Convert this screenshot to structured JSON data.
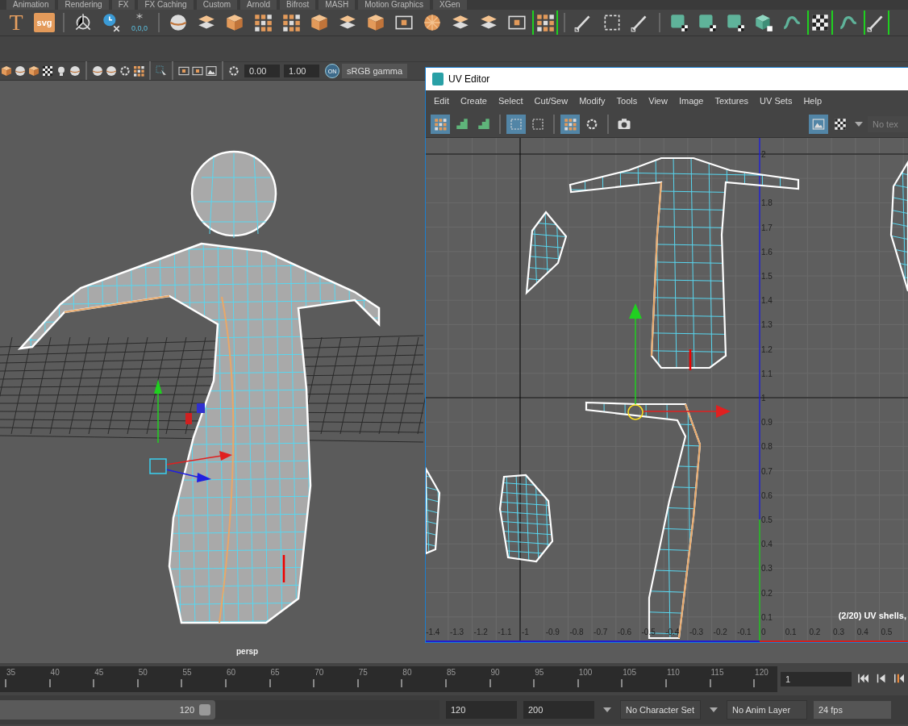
{
  "shelf_tabs": [
    "Animation",
    "Rendering",
    "FX",
    "FX Caching",
    "Custom",
    "Arnold",
    "Bifrost",
    "MASH",
    "Motion Graphics",
    "XGen"
  ],
  "shelf_groups": [
    [
      {
        "kind": "text",
        "label": "T",
        "selected": false
      },
      {
        "kind": "badge",
        "label": "svg",
        "selected": false
      }
    ],
    [
      {
        "kind": "pivot",
        "selected": false
      },
      {
        "kind": "clock",
        "selected": false
      },
      {
        "kind": "snowflake",
        "label": "0,0,0",
        "selected": false
      }
    ],
    [
      {
        "kind": "sphere",
        "selected": false
      },
      {
        "kind": "tiles",
        "selected": false
      },
      {
        "kind": "cube",
        "selected": false
      },
      {
        "kind": "grid",
        "selected": false
      },
      {
        "kind": "grid",
        "selected": false
      },
      {
        "kind": "cube",
        "selected": false
      },
      {
        "kind": "tiles",
        "selected": false
      },
      {
        "kind": "cube",
        "selected": false
      },
      {
        "kind": "square",
        "selected": false
      },
      {
        "kind": "wheel",
        "selected": false
      },
      {
        "kind": "tiles",
        "selected": false
      },
      {
        "kind": "tiles",
        "selected": false
      },
      {
        "kind": "square",
        "selected": false
      },
      {
        "kind": "grid",
        "selected": true
      }
    ],
    [
      {
        "kind": "pen",
        "selected": false
      },
      {
        "kind": "frame",
        "selected": false
      },
      {
        "kind": "pen",
        "selected": false
      }
    ],
    [
      {
        "kind": "teal-square",
        "selected": false
      },
      {
        "kind": "teal-square",
        "selected": false
      },
      {
        "kind": "teal-square",
        "selected": false
      },
      {
        "kind": "teal-cube",
        "selected": false
      },
      {
        "kind": "wave",
        "selected": false
      },
      {
        "kind": "checker",
        "selected": true
      },
      {
        "kind": "wave",
        "selected": false
      },
      {
        "kind": "pen",
        "selected": true
      }
    ]
  ],
  "viewport_toolbar": {
    "groups": [
      [
        {
          "kind": "cube"
        },
        {
          "kind": "sphere"
        },
        {
          "kind": "cube"
        },
        {
          "kind": "checker"
        },
        {
          "kind": "bulb"
        },
        {
          "kind": "sphere"
        }
      ],
      [
        {
          "kind": "sphere"
        },
        {
          "kind": "sphere"
        },
        {
          "kind": "ring"
        },
        {
          "kind": "grid"
        }
      ],
      [
        {
          "kind": "select"
        }
      ],
      [
        {
          "kind": "square"
        },
        {
          "kind": "square"
        },
        {
          "kind": "image"
        }
      ],
      [
        {
          "kind": "ring"
        }
      ]
    ],
    "exposure": "0.00",
    "gamma": "1.00",
    "color_management": {
      "label": "ON",
      "on": true
    },
    "view_transform": "sRGB gamma"
  },
  "viewport": {
    "camera": "persp"
  },
  "uv_editor": {
    "title": "UV Editor",
    "menus": [
      "Edit",
      "Create",
      "Select",
      "Cut/Sew",
      "Modify",
      "Tools",
      "View",
      "Image",
      "Textures",
      "UV Sets",
      "Help"
    ],
    "toolbar_groups": [
      [
        {
          "kind": "grid",
          "selected": true
        },
        {
          "kind": "stairs",
          "selected": false
        },
        {
          "kind": "stairs",
          "selected": false
        }
      ],
      [
        {
          "kind": "frame",
          "selected": true
        },
        {
          "kind": "frame",
          "selected": false
        }
      ],
      [
        {
          "kind": "grid",
          "selected": true
        },
        {
          "kind": "ring",
          "selected": false
        }
      ],
      [
        {
          "kind": "camera",
          "selected": false
        }
      ]
    ],
    "image_buttons": [
      {
        "kind": "image",
        "selected": true
      },
      {
        "kind": "checker",
        "selected": false
      }
    ],
    "texture_field": "No tex",
    "u_labels": [
      "-1.4",
      "-1.3",
      "-1.2",
      "-1.1",
      "-1",
      "-0.9",
      "-0.8",
      "-0.7",
      "-0.6",
      "-0.5",
      "-0.4",
      "-0.3",
      "-0.2",
      "-0.1",
      "0",
      "0.1",
      "0.2",
      "0.3",
      "0.4",
      "0.5"
    ],
    "v_labels": [
      "2",
      "1.8",
      "1.7",
      "1.6",
      "1.5",
      "1.4",
      "1.3",
      "1.2",
      "1.1",
      "1",
      "0.9",
      "0.8",
      "0.7",
      "0.6",
      "0.5",
      "0.4",
      "0.3",
      "0.2",
      "0.1"
    ],
    "status": "(2/20) UV shells,"
  },
  "timeline": {
    "ticks": [
      "35",
      "40",
      "45",
      "50",
      "55",
      "60",
      "65",
      "70",
      "75",
      "80",
      "85",
      "90",
      "95",
      "100",
      "105",
      "110",
      "115",
      "120"
    ],
    "current_frame": "1"
  },
  "range": {
    "level": 0.49,
    "slider_end": "120",
    "playback_end": "120",
    "animation_end": "200",
    "character_set": "No Character Set",
    "anim_layer": "No Anim Layer",
    "fps": "24 fps"
  }
}
